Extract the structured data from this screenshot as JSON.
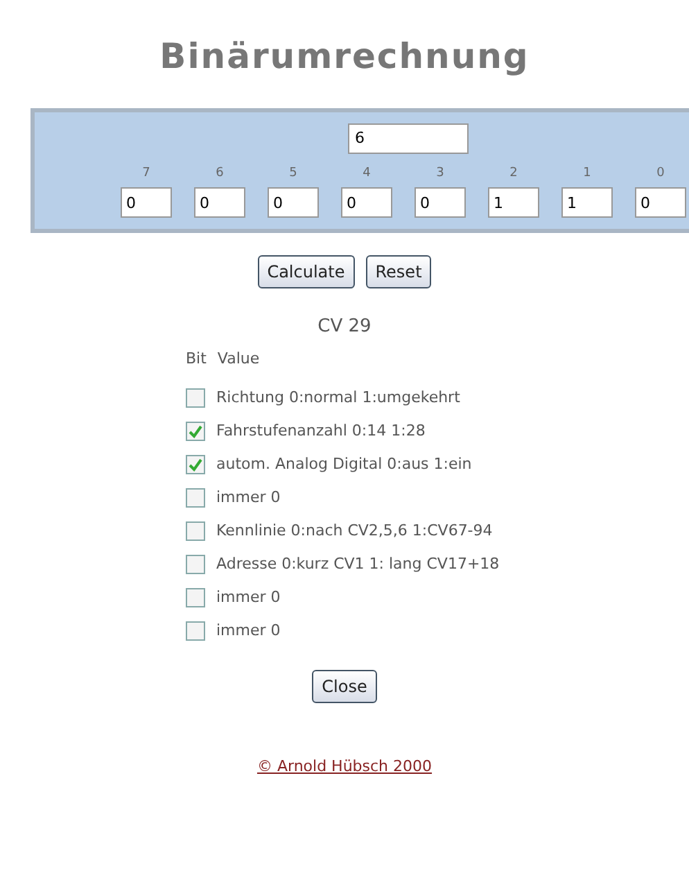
{
  "title": "Binärumrechnung",
  "decimal": {
    "value": "6"
  },
  "bits": [
    {
      "label": "7",
      "value": "0"
    },
    {
      "label": "6",
      "value": "0"
    },
    {
      "label": "5",
      "value": "0"
    },
    {
      "label": "4",
      "value": "0"
    },
    {
      "label": "3",
      "value": "0"
    },
    {
      "label": "2",
      "value": "1"
    },
    {
      "label": "1",
      "value": "1"
    },
    {
      "label": "0",
      "value": "0"
    }
  ],
  "buttons": [
    "Calculate",
    "Reset"
  ],
  "cv": {
    "title": "CV 29",
    "columns": [
      "Bit",
      "Value"
    ],
    "rows": [
      {
        "label": "Richtung 0:normal 1:umgekehrt",
        "checked": false
      },
      {
        "label": "Fahrstufenanzahl 0:14 1:28",
        "checked": true
      },
      {
        "label": "autom. Analog Digital 0:aus 1:ein",
        "checked": true
      },
      {
        "label": "immer 0",
        "checked": false
      },
      {
        "label": "Kennlinie 0:nach CV2,5,6 1:CV67-94",
        "checked": false
      },
      {
        "label": "Adresse 0:kurz CV1 1: lang CV17+18",
        "checked": false
      },
      {
        "label": "immer 0",
        "checked": false
      },
      {
        "label": "immer 0",
        "checked": false
      }
    ]
  },
  "close_button": "Close",
  "footer": "© Arnold Hübsch 2000"
}
